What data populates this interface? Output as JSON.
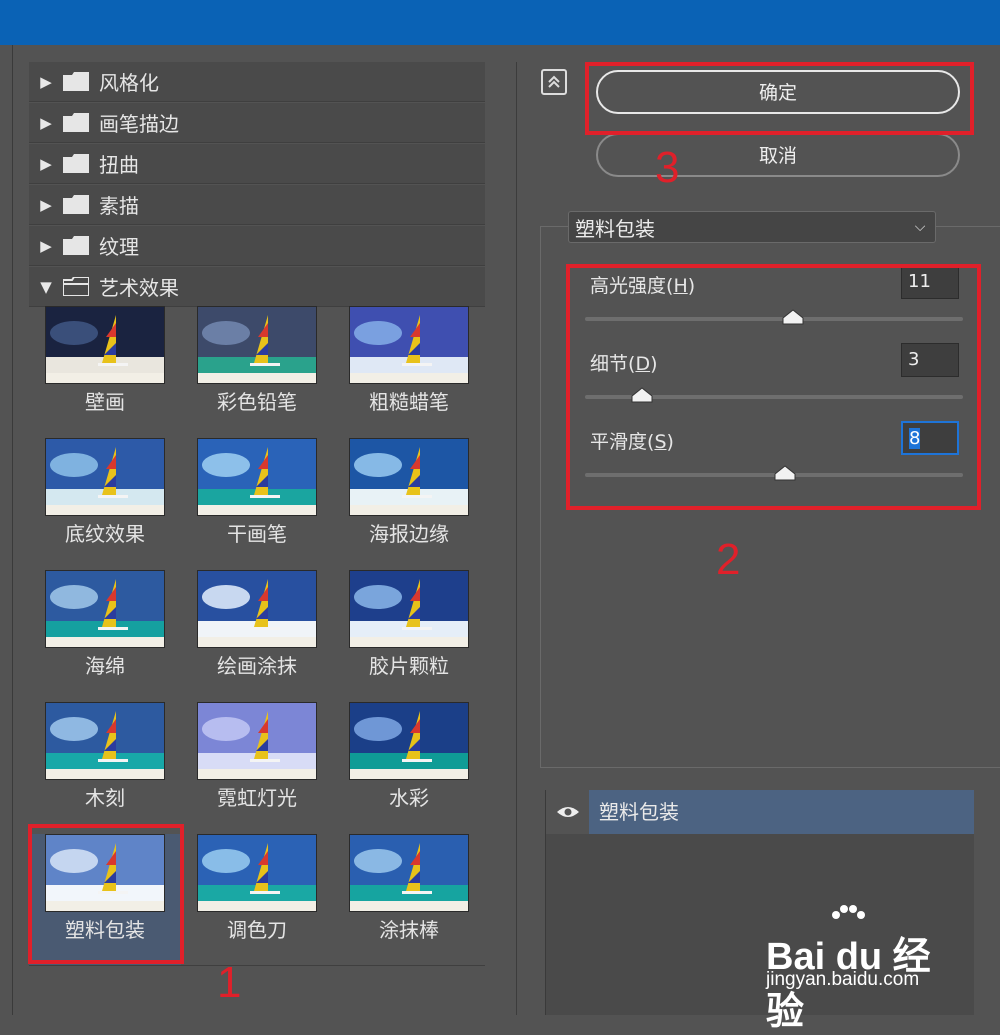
{
  "categories": [
    {
      "label": "风格化",
      "expanded": false
    },
    {
      "label": "画笔描边",
      "expanded": false
    },
    {
      "label": "扭曲",
      "expanded": false
    },
    {
      "label": "素描",
      "expanded": false
    },
    {
      "label": "纹理",
      "expanded": false
    },
    {
      "label": "艺术效果",
      "expanded": true
    }
  ],
  "thumbnails": [
    {
      "label": "壁画"
    },
    {
      "label": "彩色铅笔"
    },
    {
      "label": "粗糙蜡笔"
    },
    {
      "label": "底纹效果"
    },
    {
      "label": "干画笔"
    },
    {
      "label": "海报边缘"
    },
    {
      "label": "海绵"
    },
    {
      "label": "绘画涂抹"
    },
    {
      "label": "胶片颗粒"
    },
    {
      "label": "木刻"
    },
    {
      "label": "霓虹灯光"
    },
    {
      "label": "水彩"
    },
    {
      "label": "塑料包装",
      "selected": true
    },
    {
      "label": "调色刀"
    },
    {
      "label": "涂抹棒"
    }
  ],
  "buttons": {
    "ok": "确定",
    "cancel": "取消"
  },
  "filter_select": {
    "value": "塑料包装"
  },
  "params": [
    {
      "label": "高光强度",
      "key": "H",
      "value": "11",
      "slider": 0.55
    },
    {
      "label": "细节",
      "key": "D",
      "value": "3",
      "slider": 0.15
    },
    {
      "label": "平滑度",
      "key": "S",
      "value": "8",
      "slider": 0.53
    }
  ],
  "layer": {
    "name": "塑料包装"
  },
  "annotations": {
    "n1": "1",
    "n2": "2",
    "n3": "3"
  },
  "watermark": {
    "logo": "Bai du 经验",
    "url": "jingyan.baidu.com"
  },
  "colors": {
    "titlebar": "#0a62b5",
    "annotation": "#e0202a",
    "selected": "#4a5a72",
    "layer_selected": "#4c6382"
  },
  "icons": {
    "expand": "collapse-panel-icon",
    "eye": "eye-icon",
    "folder": "folder-icon"
  }
}
